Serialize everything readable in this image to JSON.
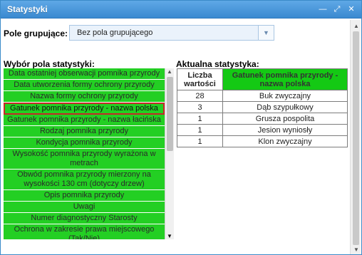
{
  "window": {
    "title": "Statystyki",
    "tools": {
      "minimize": "—",
      "restore": "⤢",
      "close": "✕"
    }
  },
  "grouping": {
    "label": "Pole grupujące:",
    "selected": "Bez pola grupującego",
    "dropdown_arrow": "▼"
  },
  "field_list": {
    "title": "Wybór pola statystyki:",
    "items": [
      "Data ostatniej obserwacji pomnika przyrody",
      "Data utworzenia formy ochrony przyrody",
      "Nazwa formy ochrony przyrody",
      "Gatunek pomnika przyrody - nazwa polska",
      "Gatunek pomnika przyrody - nazwa łacińska",
      "Rodzaj pomnika przyrody",
      "Kondycja pomnika przyrody",
      "Wysokość pomnika przyrody wyrażona w metrach",
      "Obwód pomnika przyrody mierzony na wysokości 130 cm (dotyczy drzew)",
      "Opis pomnika przyrody",
      "Uwagi",
      "Numer diagnostyczny Starosty",
      "Ochrona w zakresie prawa miejscowego (Tak/Nie)"
    ],
    "selected_index": 3
  },
  "stats": {
    "title": "Aktualna statystyka:",
    "headers": [
      "Liczba wartości",
      "Gatunek pomnika przyrody - nazwa polska"
    ],
    "rows": [
      [
        "28",
        "Buk zwyczajny"
      ],
      [
        "3",
        "Dąb szypułkowy"
      ],
      [
        "1",
        "Grusza pospolita"
      ],
      [
        "1",
        "Jesion wyniosły"
      ],
      [
        "1",
        "Klon zwyczajny"
      ]
    ]
  },
  "colors": {
    "list_background": "#23cf23",
    "selection_border": "#c62828",
    "header_green": "#14c914",
    "titlebar": "#3a89d0"
  }
}
